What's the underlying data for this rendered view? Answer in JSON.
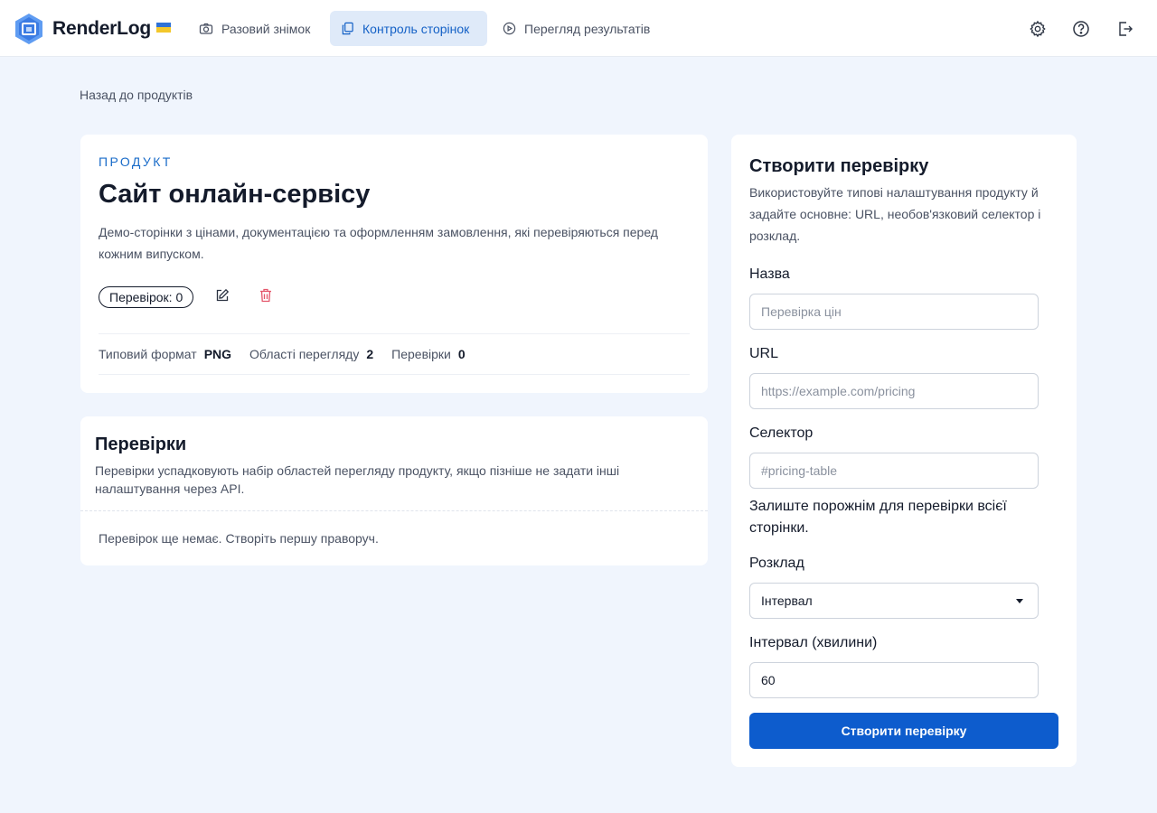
{
  "app": {
    "name": "RenderLog"
  },
  "nav": {
    "items": [
      {
        "label": "Разовий знімок",
        "icon": "camera-icon"
      },
      {
        "label": "Контроль сторінок",
        "icon": "copy-icon",
        "active": true
      },
      {
        "label": "Перегляд результатів",
        "icon": "play-circle-icon"
      }
    ]
  },
  "toolbar": {
    "icons": [
      "gear-icon",
      "help-icon",
      "logout-icon"
    ]
  },
  "breadcrumb": {
    "back_label": "Назад до продуктів"
  },
  "product": {
    "eyebrow": "ПРОДУКТ",
    "title": "Сайт онлайн-сервісу",
    "description": "Демо-сторінки з цінами, документацією та оформленням замовлення, які перевіряються перед кожним випуском.",
    "checks_badge_label": "Перевірок",
    "checks_badge_count": "0",
    "stats": [
      {
        "label": "Типовий формат",
        "value": "PNG"
      },
      {
        "label": "Області перегляду",
        "value": "2"
      },
      {
        "label": "Перевірки",
        "value": "0"
      }
    ]
  },
  "checks": {
    "title": "Перевірки",
    "description": "Перевірки успадковують набір областей перегляду продукту, якщо пізніше не задати інші налаштування через API.",
    "empty_text": "Перевірок ще немає. Створіть першу праворуч."
  },
  "form": {
    "title": "Створити перевірку",
    "description": "Використовуйте типові налаштування продукту й задайте основне: URL, необов'язковий селектор і розклад.",
    "name_label": "Назва",
    "name_placeholder": "Перевірка цін",
    "url_label": "URL",
    "url_placeholder": "https://example.com/pricing",
    "selector_label": "Селектор",
    "selector_placeholder": "#pricing-table",
    "selector_hint": "Залиште порожнім для перевірки всієї сторінки.",
    "schedule_label": "Розклад",
    "schedule_value": "Інтервал",
    "interval_label": "Інтервал (хвилини)",
    "interval_value": "60",
    "submit_label": "Створити перевірку"
  },
  "colors": {
    "accent": "#0d5ccd",
    "background": "#f0f5fd",
    "danger": "#e4566b"
  }
}
